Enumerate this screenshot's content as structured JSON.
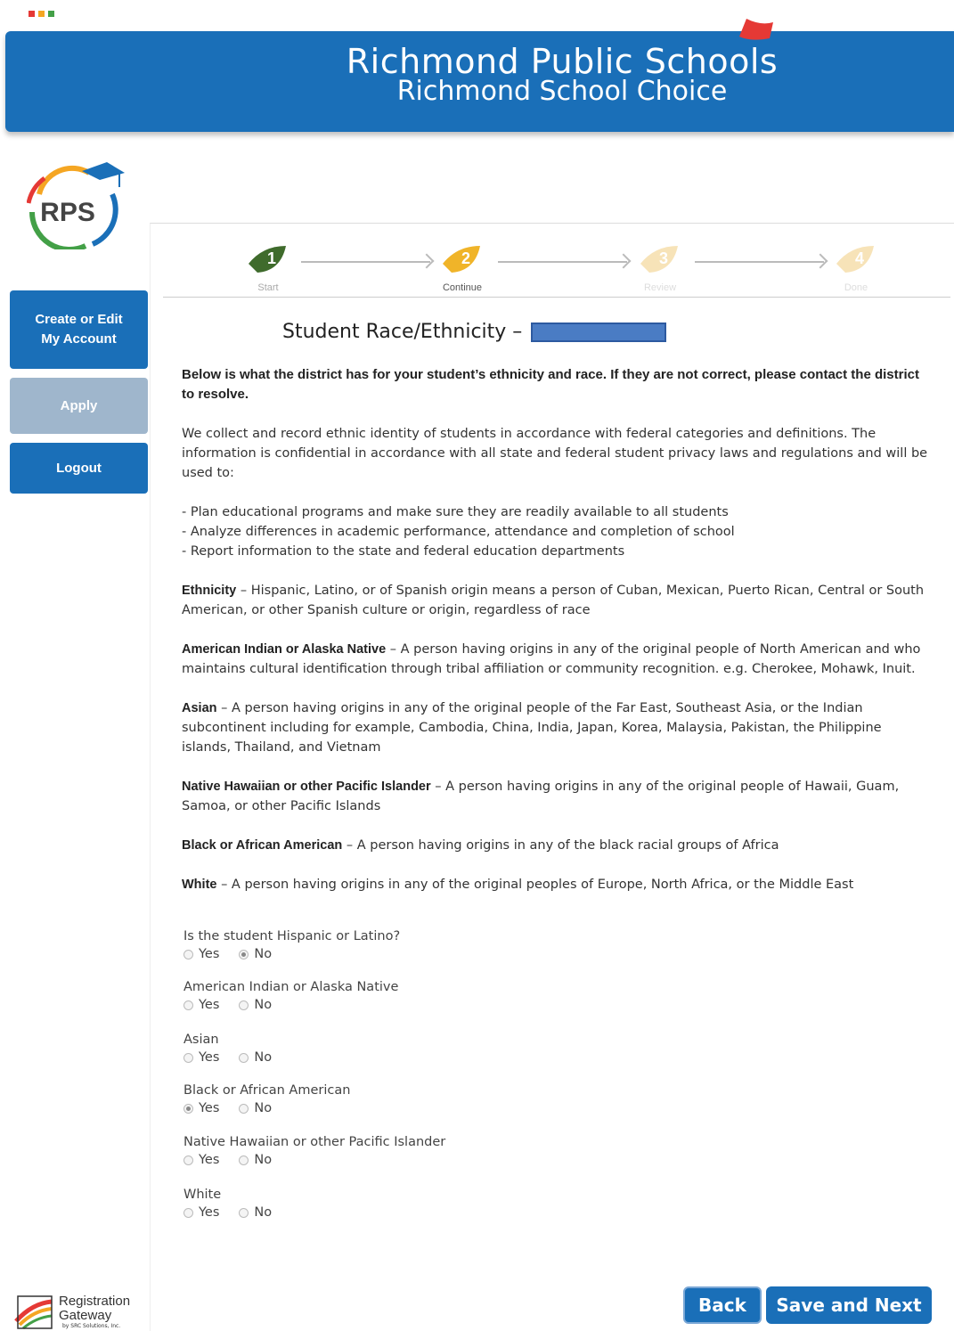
{
  "header": {
    "title": "Richmond Public Schools",
    "subtitle": "Richmond School Choice"
  },
  "colors": {
    "brand": "#1a6fb8",
    "disabled": "#9fb6cc"
  },
  "logo": {
    "text": "RPS"
  },
  "sidebar": {
    "create_line1": "Create or Edit",
    "create_line2": "My Account",
    "apply": "Apply",
    "logout": "Logout"
  },
  "steps": [
    {
      "num": "1",
      "label": "Start",
      "state": "done"
    },
    {
      "num": "2",
      "label": "Continue",
      "state": "current"
    },
    {
      "num": "3",
      "label": "Review",
      "state": "pending"
    },
    {
      "num": "4",
      "label": "Done",
      "state": "pending"
    }
  ],
  "page": {
    "heading": "Student Race/Ethnicity –",
    "lead": "Below is what the district has for your student’s ethnicity and race. If they are not correct, please contact the district to resolve.",
    "intro": "We collect and record ethnic identity of students in accordance with federal categories and definitions. The information is confidential in accordance with all state and federal student privacy laws and regulations and will be used to:",
    "uses": [
      "- Plan educational programs and make sure they are readily available to all students",
      "- Analyze differences in academic performance, attendance and completion of school",
      "- Report information to the state and federal education departments"
    ],
    "definitions": [
      {
        "term": "Ethnicity",
        "text": " – Hispanic, Latino, or of Spanish origin means a person of Cuban, Mexican, Puerto Rican, Central or South American, or other Spanish culture or origin, regardless of race"
      },
      {
        "term": "American Indian or Alaska Native",
        "text": " – A person having origins in any of the original people of North American and who maintains cultural identification through tribal affiliation or community recognition. e.g. Cherokee, Mohawk, Inuit."
      },
      {
        "term": "Asian",
        "text": " – A person having origins in any of the original people of the Far East, Southeast Asia, or the Indian subcontinent including for example, Cambodia, China, India, Japan, Korea, Malaysia, Pakistan, the Philippine islands, Thailand, and Vietnam"
      },
      {
        "term": "Native Hawaiian or other Pacific Islander",
        "text": " – A person having origins in any of the original people of Hawaii, Guam, Samoa, or other Pacific Islands"
      },
      {
        "term": "Black or African American",
        "text": " – A person having origins in any of the black racial groups of Africa"
      },
      {
        "term": "White",
        "text": " – A person having origins in any of the original peoples of Europe, North Africa, or the Middle East"
      }
    ]
  },
  "questions": [
    {
      "label": "Is the student Hispanic or Latino?",
      "yes": "Yes",
      "no": "No",
      "selected": "No"
    },
    {
      "label": "American Indian or Alaska Native",
      "yes": "Yes",
      "no": "No",
      "selected": ""
    },
    {
      "label": "Asian",
      "yes": "Yes",
      "no": "No",
      "selected": ""
    },
    {
      "label": "Black or African American",
      "yes": "Yes",
      "no": "No",
      "selected": "Yes"
    },
    {
      "label": "Native Hawaiian or other Pacific Islander",
      "yes": "Yes",
      "no": "No",
      "selected": ""
    },
    {
      "label": "White",
      "yes": "Yes",
      "no": "No",
      "selected": ""
    }
  ],
  "footer": {
    "brand_line1": "Registration",
    "brand_line2": "Gateway",
    "brand_small": "by SRC Solutions, Inc.",
    "back": "Back",
    "save_next": "Save and Next"
  }
}
